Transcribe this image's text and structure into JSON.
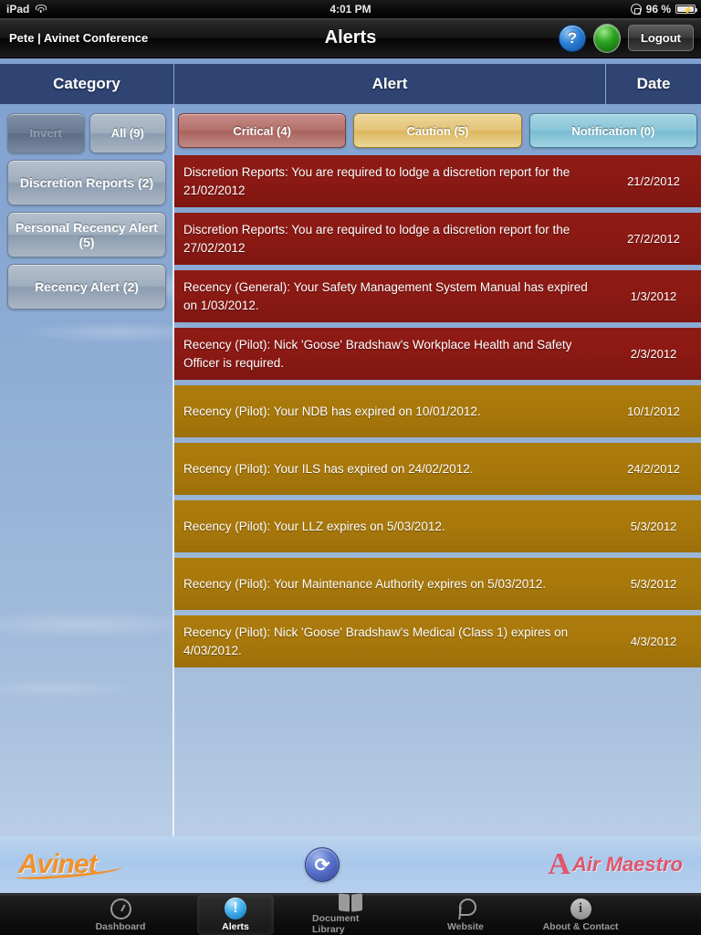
{
  "status_bar": {
    "device": "iPad",
    "wifi_icon": "wifi-icon",
    "time": "4:01 PM",
    "rotation_lock_icon": "rotation-lock-icon",
    "battery_percent": "96 %",
    "battery_icon": "battery-charging-icon"
  },
  "nav_bar": {
    "user": "Pete | Avinet Conference",
    "title": "Alerts",
    "help_label": "?",
    "help_icon": "question-mark-icon",
    "status_indicator_icon": "green-status-icon",
    "logout_label": "Logout"
  },
  "columns": {
    "category": "Category",
    "alert": "Alert",
    "date": "Date"
  },
  "sidebar": {
    "invert_label": "Invert",
    "all_label": "All (9)",
    "filters": [
      {
        "label": "Discretion Reports (2)"
      },
      {
        "label": "Personal Recency Alert (5)"
      },
      {
        "label": "Recency Alert (2)"
      }
    ]
  },
  "severity_filters": [
    {
      "label": "Critical (4)",
      "key": "critical",
      "color": "#b4716c"
    },
    {
      "label": "Caution (5)",
      "key": "caution",
      "color": "#e3c478"
    },
    {
      "label": "Notification (0)",
      "key": "notification",
      "color": "#8bc6d9"
    }
  ],
  "alerts": [
    {
      "message": "Discretion Reports: You are required to lodge a discretion report for the 21/02/2012",
      "date": "21/2/2012",
      "severity": "critical"
    },
    {
      "message": "Discretion Reports: You are required to lodge a discretion report for the 27/02/2012",
      "date": "27/2/2012",
      "severity": "critical"
    },
    {
      "message": "Recency (General): Your Safety Management System Manual has expired on 1/03/2012.",
      "date": "1/3/2012",
      "severity": "critical"
    },
    {
      "message": "Recency (Pilot): Nick 'Goose' Bradshaw's Workplace Health and Safety Officer is required.",
      "date": "2/3/2012",
      "severity": "critical"
    },
    {
      "message": "Recency (Pilot): Your NDB has expired on 10/01/2012.",
      "date": "10/1/2012",
      "severity": "caution"
    },
    {
      "message": "Recency (Pilot): Your ILS has expired on 24/02/2012.",
      "date": "24/2/2012",
      "severity": "caution"
    },
    {
      "message": "Recency (Pilot): Your LLZ expires on 5/03/2012.",
      "date": "5/3/2012",
      "severity": "caution"
    },
    {
      "message": "Recency (Pilot): Your Maintenance Authority expires on 5/03/2012.",
      "date": "5/3/2012",
      "severity": "caution"
    },
    {
      "message": "Recency (Pilot): Nick 'Goose' Bradshaw's Medical (Class 1) expires on 4/03/2012.",
      "date": "4/3/2012",
      "severity": "caution"
    }
  ],
  "brand_bar": {
    "left_logo": "Avinet",
    "refresh_icon": "refresh-icon",
    "right_logo": "Air Maestro",
    "right_logo_mark": "A"
  },
  "tabs": [
    {
      "label": "Dashboard",
      "icon": "gauge-icon",
      "active": false
    },
    {
      "label": "Alerts",
      "icon": "alert-exclamation-icon",
      "active": true
    },
    {
      "label": "Document Library",
      "icon": "book-icon",
      "active": false
    },
    {
      "label": "Website",
      "icon": "link-pin-icon",
      "active": false
    },
    {
      "label": "About & Contact",
      "icon": "info-icon",
      "active": false
    }
  ],
  "colors": {
    "critical": "#8b1914",
    "caution": "#a8780b",
    "header_navy": "#2f4473",
    "sky": "#8aa9d3"
  }
}
